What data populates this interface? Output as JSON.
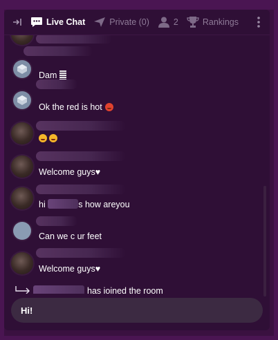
{
  "tabs": {
    "live_chat": "Live Chat",
    "private": "Private (0)",
    "users_count": "2",
    "rankings": "Rankings"
  },
  "messages": [
    {
      "text": "Dam"
    },
    {
      "text": "Ok the red is hot"
    },
    {
      "text": ""
    },
    {
      "text": "Welcome guys♥"
    },
    {
      "text_before": "hi",
      "text_after": "s how areyou"
    },
    {
      "text": "Can we c ur feet"
    },
    {
      "text": "Welcome guys♥"
    }
  ],
  "join": {
    "text": "has joined the room"
  },
  "input": {
    "value": "Hi!"
  },
  "colors": {
    "background": "#2f0f36",
    "outer": "#3a1140",
    "input_bg": "#3c2a42"
  }
}
